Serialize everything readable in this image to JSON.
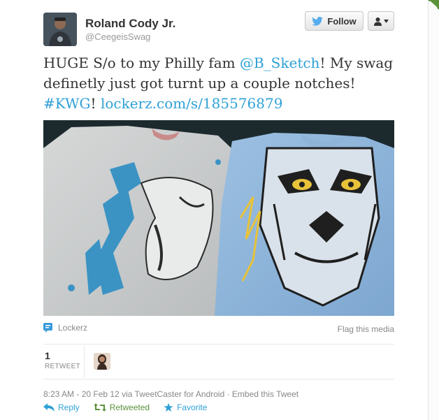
{
  "tweet": {
    "author_name": "Roland Cody Jr.",
    "author_handle": "@CeegeisSwag",
    "text_part1": "HUGE S/o to my Philly fam ",
    "mention": "@B_Sketch",
    "text_part2": "! My swag definetly just got turnt up a couple notches! ",
    "hashtag": "#KWG",
    "text_part3": "! ",
    "link": "lockerz.com/s/185576879"
  },
  "buttons": {
    "follow": "Follow"
  },
  "media": {
    "source": "Lockerz",
    "flag": "Flag this media"
  },
  "stats": {
    "retweet_count": "1",
    "retweet_label": "RETWEET"
  },
  "meta": {
    "timestamp": "8:23 AM - 20 Feb 12 via TweetCaster for Android · Embed this Tweet"
  },
  "actions": {
    "reply": "Reply",
    "retweeted": "Retweeted",
    "favorite": "Favorite"
  },
  "colors": {
    "link": "#2fa0d6",
    "retweeted": "#5c913b",
    "twitter_blue": "#55acee"
  },
  "icons": [
    "twitter-bird-icon",
    "user-icon",
    "caret-down-icon",
    "lockerz-icon",
    "reply-icon",
    "retweet-icon",
    "star-icon",
    "corner-fold-icon"
  ]
}
